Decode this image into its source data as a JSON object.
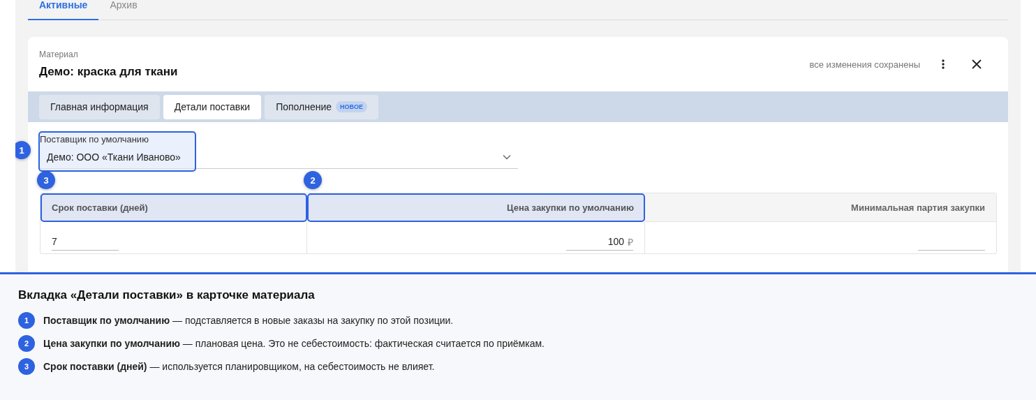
{
  "top_tabs": [
    {
      "label": "Активные",
      "selected": true
    },
    {
      "label": "Архив",
      "selected": false
    }
  ],
  "card": {
    "overline": "Материал",
    "title": "Демо: краска для ткани",
    "save_status": "все изменения сохранены",
    "tabs": [
      {
        "label": "Главная информация",
        "selected": false
      },
      {
        "label": "Детали поставки",
        "selected": true
      },
      {
        "label": "Пополнение",
        "selected": false,
        "badge": "НОВОЕ"
      }
    ],
    "supplier": {
      "label": "Поставщик по умолчанию",
      "value": "Демо: ООО «Ткани Иваново»",
      "callout": "1"
    },
    "table": {
      "columns": [
        {
          "label": "Срок поставки (дней)",
          "kind": "text",
          "callout": "3"
        },
        {
          "label": "Цена закупки по умолчанию",
          "kind": "number",
          "callout": "2"
        },
        {
          "label": "Минимальная партия закупки",
          "kind": "number"
        }
      ],
      "cells": [
        {
          "value": "7"
        },
        {
          "value": "100",
          "suffix": "₽"
        },
        {}
      ]
    }
  },
  "caption": {
    "title": "Вкладка «Детали поставки» в карточке материала",
    "items": [
      {
        "number": "1",
        "text": "**Поставщик по умолчанию** — подставляется в новые заказы на закупку по этой позиции."
      },
      {
        "number": "2",
        "text": "**Цена закупки по умолчанию** — плановая цена. Это не себестоимость: фактическая считается по приёмкам."
      },
      {
        "number": "3",
        "text": "**Срок поставки (дней)** — используется планировщиком, на себестоимость не влияет."
      }
    ]
  }
}
